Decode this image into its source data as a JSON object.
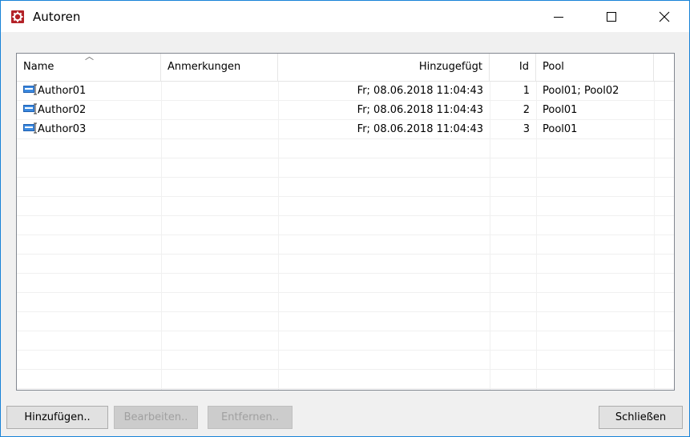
{
  "window": {
    "title": "Autoren"
  },
  "columns": [
    "Name",
    "Anmerkungen",
    "Hinzugefügt",
    "Id",
    "Pool"
  ],
  "rows": [
    {
      "name": "Author01",
      "notes": "",
      "added": "Fr; 08.06.2018 11:04:43",
      "id": "1",
      "pool": "Pool01; Pool02"
    },
    {
      "name": "Author02",
      "notes": "",
      "added": "Fr; 08.06.2018 11:04:43",
      "id": "2",
      "pool": "Pool01"
    },
    {
      "name": "Author03",
      "notes": "",
      "added": "Fr; 08.06.2018 11:04:43",
      "id": "3",
      "pool": "Pool01"
    }
  ],
  "buttons": {
    "add": "Hinzufügen..",
    "edit": "Bearbeiten..",
    "remove": "Entfernen..",
    "close": "Schließen"
  },
  "colors": {
    "accent": "#1883d7",
    "app_icon": "#b32127"
  }
}
